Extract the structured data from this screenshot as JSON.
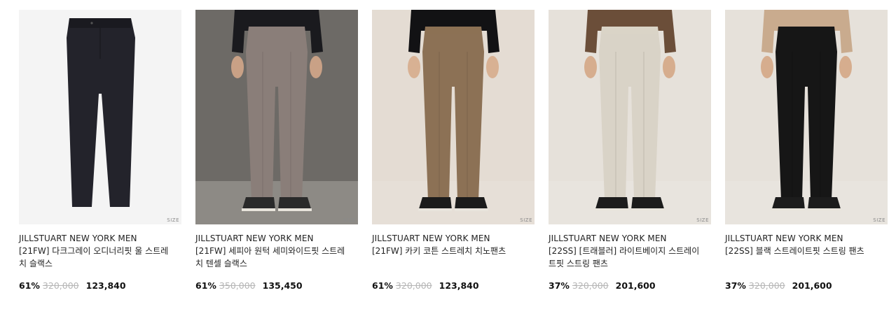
{
  "size_tag": "SIZE",
  "products": [
    {
      "brand": "JILLSTUART NEW YORK MEN",
      "name": "[21FW] 다크그레이 오디너리핏 울 스트레치 슬랙스",
      "discount": "61%",
      "original_price": "320,000",
      "price": "123,840",
      "image": {
        "background": "#f4f4f4",
        "wall": "#f4f4f4",
        "floor": "#f4f4f4",
        "pants": "#23232b",
        "top": null,
        "skin": null,
        "shoes": null,
        "flat": true
      }
    },
    {
      "brand": "JILLSTUART NEW YORK MEN",
      "name": "[21FW] 세피아 원턱 세미와이드핏 스트레치 텐셀 슬랙스",
      "discount": "61%",
      "original_price": "350,000",
      "price": "135,450",
      "image": {
        "background": "#6d6a66",
        "wall": "#6d6a66",
        "floor": "#8d8a85",
        "pants": "#8a7e79",
        "top": "#1a1a1e",
        "skin": "#c9a186",
        "shoes": "#2a2a2a",
        "flat": false
      }
    },
    {
      "brand": "JILLSTUART NEW YORK MEN",
      "name": "[21FW] 카키 코튼 스트레치 치노팬츠",
      "discount": "61%",
      "original_price": "320,000",
      "price": "123,840",
      "image": {
        "background": "#e4dcd3",
        "wall": "#e4dcd3",
        "floor": "#e6dfd7",
        "pants": "#8c7155",
        "top": "#121214",
        "skin": "#d8b193",
        "shoes": "#1b1b1b",
        "flat": false
      }
    },
    {
      "brand": "JILLSTUART NEW YORK MEN",
      "name": "[22SS] [트래블러] 라이트베이지 스트레이트핏 스트링 팬츠",
      "discount": "37%",
      "original_price": "320,000",
      "price": "201,600",
      "image": {
        "background": "#e6e1da",
        "wall": "#e6e1da",
        "floor": "#e8e4de",
        "pants": "#d9d3c7",
        "top": "#6b4e39",
        "skin": "#d6ad8e",
        "shoes": "#1c1c1c",
        "flat": false
      }
    },
    {
      "brand": "JILLSTUART NEW YORK MEN",
      "name": "[22SS] 블랙 스트레이트핏 스트링 팬츠",
      "discount": "37%",
      "original_price": "320,000",
      "price": "201,600",
      "image": {
        "background": "#e6e1da",
        "wall": "#e6e1da",
        "floor": "#e8e4de",
        "pants": "#161616",
        "top": "#c9ab8e",
        "skin": "#d6ad8e",
        "shoes": "#1c1c1c",
        "flat": false
      }
    }
  ]
}
